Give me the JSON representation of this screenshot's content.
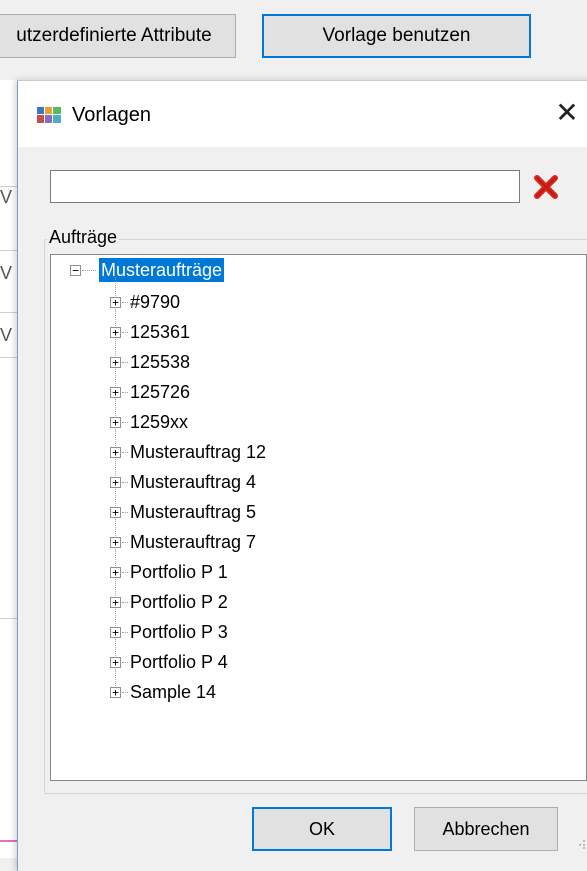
{
  "background_window": {
    "attributes_button_label": "utzerdefinierte Attribute",
    "use_template_button_label": "Vorlage benutzen",
    "row_fragments": [
      "V",
      "V",
      "V"
    ]
  },
  "dialog": {
    "title": "Vorlagen",
    "search": {
      "value": "",
      "placeholder": ""
    },
    "group_label": "Aufträge",
    "tree": {
      "root": {
        "label": "Musteraufträge",
        "expanded": true,
        "selected": true
      },
      "children": [
        "#9790",
        "125361",
        "125538",
        "125726",
        "1259xx",
        "Musterauftrag 12",
        "Musterauftrag 4",
        "Musterauftrag 5",
        "Musterauftrag 7",
        "Portfolio P 1",
        "Portfolio P 2",
        "Portfolio P 3",
        "Portfolio P 4",
        "Sample 14"
      ]
    },
    "ok_label": "OK",
    "cancel_label": "Abbrechen"
  },
  "colors": {
    "accent": "#0078d7",
    "selection_bg": "#0078d7",
    "clear_icon_red": "#d9261c"
  },
  "icons": {
    "window": "vorlagen-palette-icon",
    "close": "close-icon",
    "clear": "red-x-clear-icon",
    "expand": "plus-box-icon",
    "collapse": "minus-box-icon"
  }
}
